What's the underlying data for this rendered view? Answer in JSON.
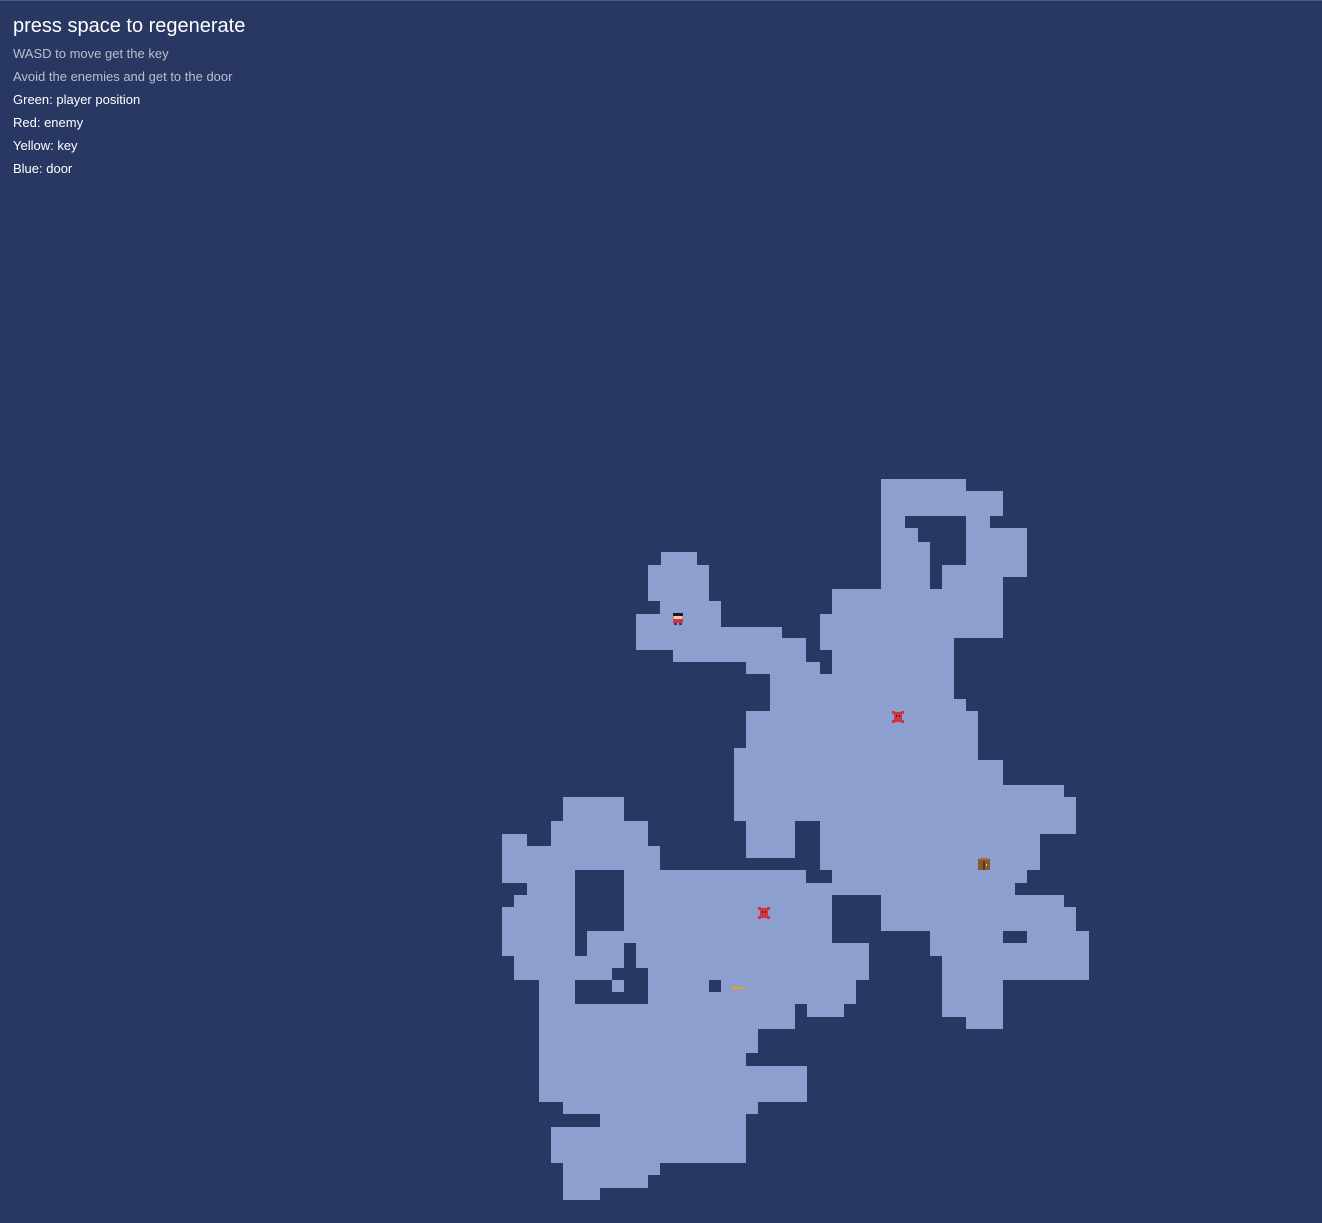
{
  "hud": {
    "title": "press space to regenerate",
    "instructions": [
      "WASD to move get the key",
      "Avoid the enemies and get to the door"
    ],
    "legend": [
      "Green: player position",
      "Red: enemy",
      "Yellow: key",
      "Blue: door"
    ]
  },
  "colors": {
    "background": "#283862",
    "floor": "#8c9fcf",
    "enemy": "#d4343f",
    "key": "#d9a33a",
    "door": "#8b5a2b",
    "text": "#ffffff",
    "text_muted": "#b9bfcc"
  },
  "entities": {
    "player": "player-sprite",
    "enemies": [
      "enemy-sprite",
      "enemy-sprite"
    ],
    "key": "key-sprite",
    "door": "door-sprite"
  }
}
